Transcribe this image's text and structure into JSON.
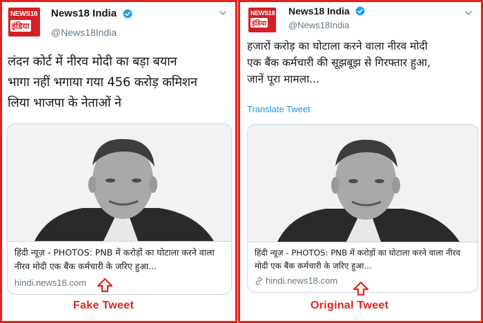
{
  "panels": [
    {
      "author": {
        "name": "News18 India",
        "handle": "@News18India"
      },
      "logo": {
        "line1": "NEWS18",
        "line2": "इंडिया"
      },
      "tweet_text": "लंदन कोर्ट में नीरव मोदी का बड़ा  बयान\nभागा नहीं भगाया गया 456 करोड़ कमिशन\nलिया  भाजपा के नेताओं ने",
      "card": {
        "title": "हिंदी न्यूज़ - PHOTOS: PNB में करोड़ों का घोटाला करने वाला नीरव मोदी एक बैंक कर्मचारी के जरिए हुआ...",
        "domain": "hindi.news18.com"
      },
      "caption": "Fake  Tweet"
    },
    {
      "author": {
        "name": "News18 India",
        "handle": "@News18India"
      },
      "logo": {
        "line1": "NEWS18",
        "line2": "इंडिया"
      },
      "tweet_text": "हजारों करोड़ का घोटाला करने वाला नीरव मोदी\nएक बैंक कर्मचारी की सूझबूझ से गिरफ्तार हुआ,\nजानें पूरा मामला...",
      "translate_label": "Translate Tweet",
      "card": {
        "title": "हिंदी न्यूज़ - PHOTOS: PNB में करोड़ों का घोटाला करने वाला नीरव मोदी एक बैंक कर्मचारी के जरिए हुआ...",
        "domain": "hindi.news18.com"
      },
      "caption": "Original  Tweet"
    }
  ],
  "colors": {
    "frame_red": "#e2231a",
    "logo_red": "#d61f26",
    "verified_blue": "#1da1f2",
    "link_blue": "#1b95e0",
    "muted_gray": "#657786"
  },
  "icons": [
    "verified-badge-icon",
    "chevron-down-icon",
    "link-icon",
    "up-arrow-icon"
  ]
}
